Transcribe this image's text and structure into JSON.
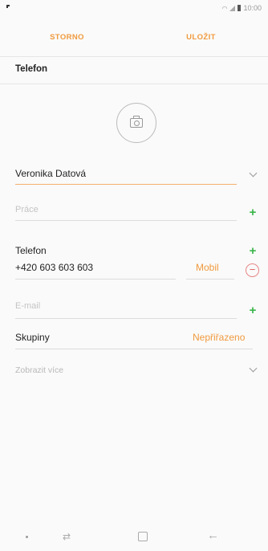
{
  "status": {
    "time": "10:00"
  },
  "toolbar": {
    "cancel_label": "STORNO",
    "save_label": "ULOŽIT"
  },
  "account": {
    "label": "Telefon"
  },
  "form": {
    "name": {
      "value": "Veronika Datová"
    },
    "work": {
      "placeholder": "Práce"
    },
    "phone": {
      "label": "Telefon",
      "value": "+420 603 603 603",
      "type": "Mobil"
    },
    "email": {
      "placeholder": "E-mail"
    },
    "groups": {
      "label": "Skupiny",
      "value": "Nepřiřazeno"
    },
    "more": {
      "label": "Zobrazit více"
    }
  },
  "nav": {
    "recents_glyph": "⇄",
    "back_glyph": "←"
  },
  "colors": {
    "accent": "#f09a3e",
    "add": "#39b54a",
    "remove": "#e15c5c"
  }
}
